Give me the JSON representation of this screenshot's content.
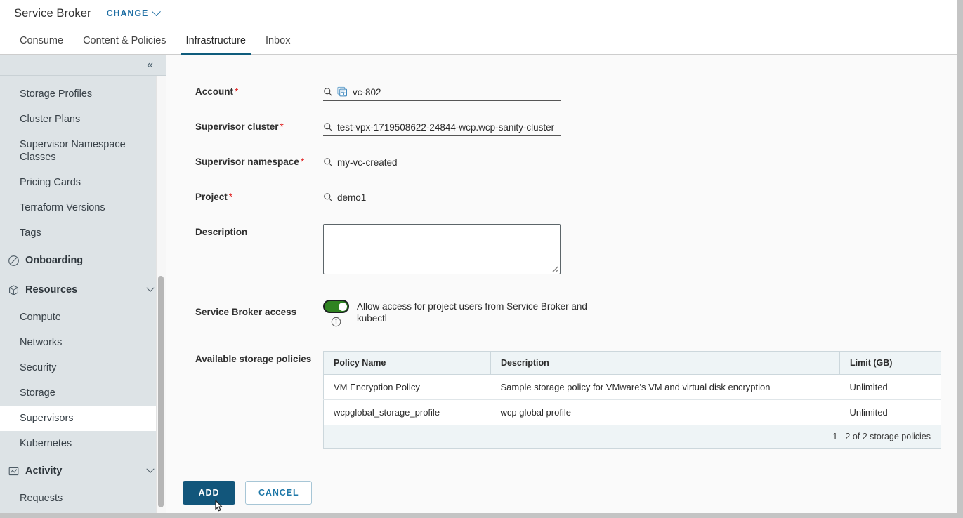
{
  "header": {
    "app_title": "Service Broker",
    "change_label": "CHANGE",
    "change_icon": "chevron-down-icon"
  },
  "tabs": [
    {
      "label": "Consume",
      "active": false
    },
    {
      "label": "Content & Policies",
      "active": false
    },
    {
      "label": "Infrastructure",
      "active": true
    },
    {
      "label": "Inbox",
      "active": false
    }
  ],
  "sidebar": {
    "collapse_icon": "double-chevron-left-icon",
    "items": [
      {
        "label": "Storage Profiles",
        "type": "item",
        "selected": false
      },
      {
        "label": "Cluster Plans",
        "type": "item",
        "selected": false
      },
      {
        "label": "Supervisor Namespace Classes",
        "type": "item",
        "selected": false,
        "two_line": true
      },
      {
        "label": "Pricing Cards",
        "type": "item",
        "selected": false
      },
      {
        "label": "Terraform Versions",
        "type": "item",
        "selected": false
      },
      {
        "label": "Tags",
        "type": "item",
        "selected": false
      },
      {
        "label": "Onboarding",
        "type": "group",
        "icon": "compass-icon",
        "expandable": false
      },
      {
        "label": "Resources",
        "type": "group",
        "icon": "cube-icon",
        "expandable": true
      },
      {
        "label": "Compute",
        "type": "item",
        "selected": false
      },
      {
        "label": "Networks",
        "type": "item",
        "selected": false
      },
      {
        "label": "Security",
        "type": "item",
        "selected": false
      },
      {
        "label": "Storage",
        "type": "item",
        "selected": false
      },
      {
        "label": "Supervisors",
        "type": "item",
        "selected": true
      },
      {
        "label": "Kubernetes",
        "type": "item",
        "selected": false
      },
      {
        "label": "Activity",
        "type": "group",
        "icon": "activity-chart-icon",
        "expandable": true
      },
      {
        "label": "Requests",
        "type": "item",
        "selected": false
      }
    ]
  },
  "form": {
    "account": {
      "label": "Account",
      "required": true,
      "value": "vc-802",
      "icon": "search-icon",
      "badge_icon": "vcenter-icon"
    },
    "supervisor_cluster": {
      "label": "Supervisor cluster",
      "required": true,
      "value": "test-vpx-1719508622-24844-wcp.wcp-sanity-cluster",
      "icon": "search-icon"
    },
    "supervisor_namespace": {
      "label": "Supervisor namespace",
      "required": true,
      "value": "my-vc-created",
      "icon": "search-icon"
    },
    "project": {
      "label": "Project",
      "required": true,
      "value": "demo1",
      "icon": "search-icon"
    },
    "description": {
      "label": "Description",
      "required": false,
      "value": "",
      "placeholder": ""
    },
    "service_broker_access": {
      "label": "Service Broker access",
      "toggle_on": true,
      "toggle_text": "Allow access for project users from Service Broker and kubectl",
      "info_icon": "info-circle-icon"
    },
    "storage_policies": {
      "label": "Available storage policies",
      "columns": [
        "Policy Name",
        "Description",
        "Limit (GB)"
      ],
      "rows": [
        {
          "policy_name": "VM Encryption Policy",
          "description": "Sample storage policy for VMware's VM and virtual disk encryption",
          "limit": "Unlimited"
        },
        {
          "policy_name": "wcpglobal_storage_profile",
          "description": "wcp global profile",
          "limit": "Unlimited"
        }
      ],
      "footer_text": "1 - 2 of 2 storage policies"
    }
  },
  "footer": {
    "add_label": "ADD",
    "cancel_label": "CANCEL"
  },
  "colors": {
    "accent": "#0f5c7c",
    "link": "#1f6ea3",
    "primary_button": "#12567b",
    "toggle_on": "#2f8321",
    "required": "#e02020",
    "sidebar_bg": "#dde3e6"
  }
}
